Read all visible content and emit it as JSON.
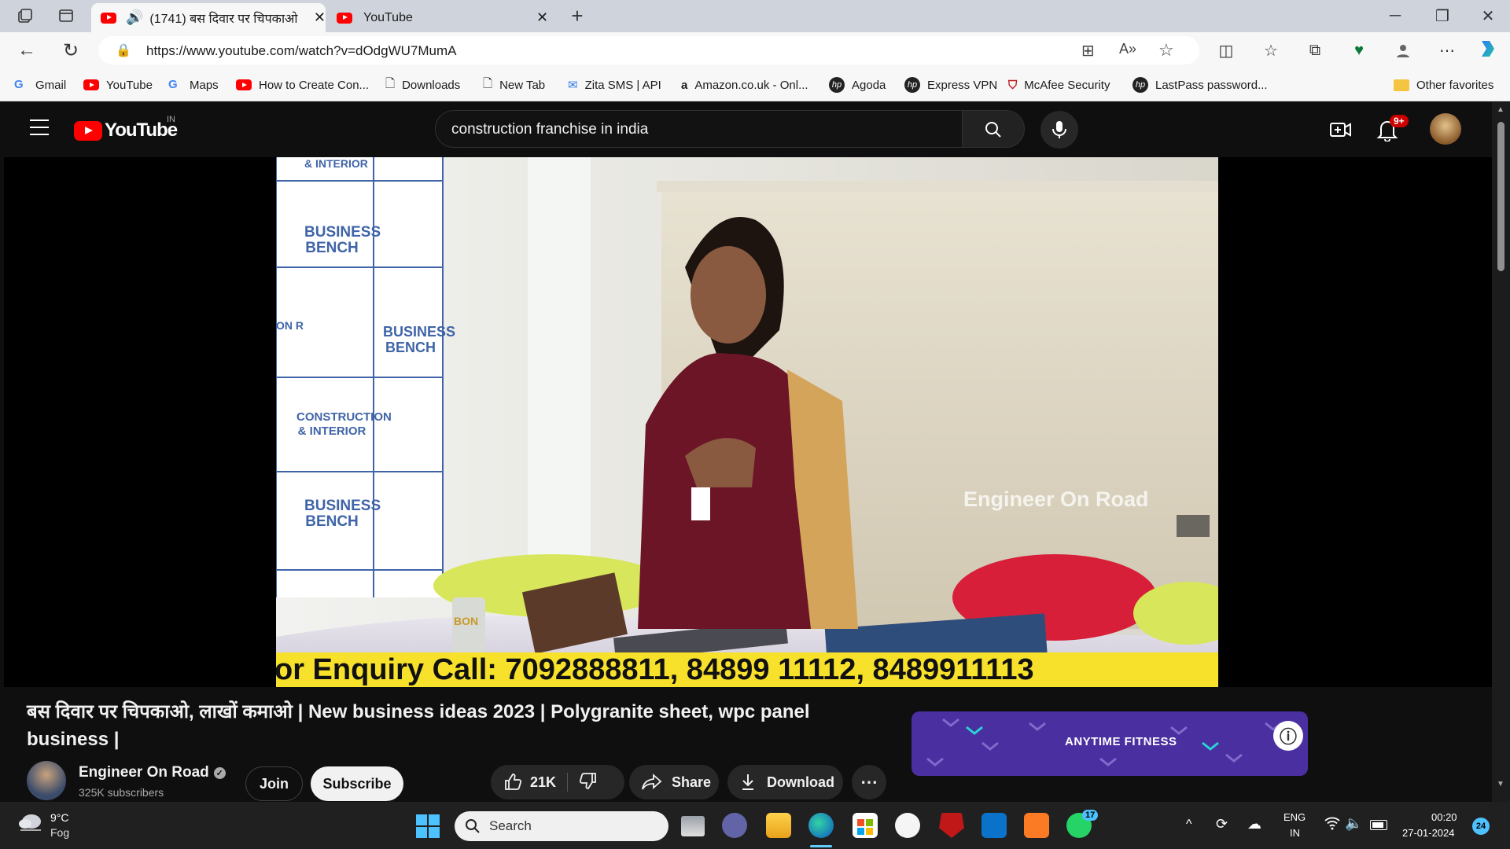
{
  "browser": {
    "tabs": [
      {
        "title": "(1741) बस दिवार पर चिपकाओ",
        "active": true
      },
      {
        "title": "YouTube",
        "active": false
      }
    ],
    "url": "https://www.youtube.com/watch?v=dOdgWU7MumA",
    "bookmarks": [
      {
        "label": "Gmail",
        "icon": "google-icon"
      },
      {
        "label": "YouTube",
        "icon": "youtube-icon"
      },
      {
        "label": "Maps",
        "icon": "google-icon"
      },
      {
        "label": "How to Create Con...",
        "icon": "youtube-icon"
      },
      {
        "label": "Downloads",
        "icon": "page-icon"
      },
      {
        "label": "New Tab",
        "icon": "page-icon"
      },
      {
        "label": "Zita SMS | API",
        "icon": "mail-icon"
      },
      {
        "label": "Amazon.co.uk - Onl...",
        "icon": "amazon-icon"
      },
      {
        "label": "Agoda",
        "icon": "hp-icon"
      },
      {
        "label": "Express VPN",
        "icon": "hp-icon"
      },
      {
        "label": "McAfee Security",
        "icon": "mcafee-icon"
      },
      {
        "label": "LastPass password...",
        "icon": "hp-icon"
      }
    ],
    "other_favorites": "Other favorites"
  },
  "youtube": {
    "logo_text": "YouTube",
    "region": "IN",
    "search_value": "construction franchise in india",
    "notifications_badge": "9+",
    "video_overlay": {
      "watermark": "Engineer On Road",
      "ticker": "or Enquiry Call: 7092888811, 84899 11112,  8489911113",
      "wall_labels": [
        "BUSINESS BENCH",
        "BUSINESS BENCH",
        "CONSTRUCTION & INTERIOR",
        "BUSINESS BENCH",
        "& INTERIOR",
        "ON R"
      ],
      "glue_label": "BON"
    },
    "video_title": "बस दिवार पर चिपकाओ, लाखों कमाओ | New business ideas 2023 | Polygranite sheet, wpc panel business |",
    "channel": {
      "name": "Engineer On Road",
      "subscribers": "325K subscribers"
    },
    "join_label": "Join",
    "subscribe_label": "Subscribe",
    "like_count": "21K",
    "share_label": "Share",
    "download_label": "Download",
    "ad": {
      "brand": "ANYTIME FITNESS"
    }
  },
  "taskbar": {
    "weather_temp": "9°C",
    "weather_desc": "Fog",
    "search_placeholder": "Search",
    "whatsapp_badge": "17",
    "lang_top": "ENG",
    "lang_bottom": "IN",
    "time": "00:20",
    "date": "27-01-2024",
    "notification_count": "24"
  },
  "colors": {
    "youtube_red": "#ff0000",
    "ticker_yellow": "#f7e12a",
    "ad_purple": "#4a2fa0",
    "taskbar": "#202020"
  }
}
